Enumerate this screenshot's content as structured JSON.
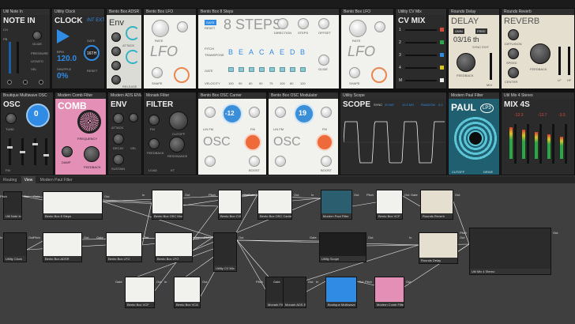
{
  "row1": {
    "note_in": {
      "header": "Util Note In",
      "name": "NOTE IN",
      "tags": [
        "CH",
        "PB",
        "MOD",
        "GLIDE",
        "PRESSURE",
        "LEGATO",
        "VEL"
      ]
    },
    "clock": {
      "header": "Utility Clock",
      "name": "CLOCK",
      "int_ext": "INT EXT",
      "bpm_label": "BPM",
      "bpm": "120.0",
      "shuffle_label": "SHUFFLE",
      "shuffle": "0%",
      "gate_label": "GATE",
      "rate": "16th",
      "reset": "RESET"
    },
    "env": {
      "header": "Bento Box ADSR",
      "name": "Env",
      "tags": [
        "ATTACK",
        "DECAY",
        "SUSTAIN",
        "RELEASE"
      ]
    },
    "lfo1": {
      "header": "Bento Box LFO",
      "name": "LFO",
      "tags": [
        "RATE",
        "PHASE",
        "SHAPE"
      ]
    },
    "steps": {
      "header": "Bento Box 8 Steps",
      "name": "8 STEPS",
      "gate_btn": "GATE",
      "reset_btn": "RESET",
      "notes": [
        "B",
        "E",
        "A",
        "C",
        "A",
        "E",
        "D",
        "B"
      ],
      "values": [
        "100",
        "90",
        "80",
        "90",
        "75",
        "100",
        "80",
        "100"
      ],
      "rows": [
        "PITCH",
        "TRANSPOSE",
        "GATE",
        "VELOCITY"
      ],
      "tags": [
        "DIRECTION",
        "STEPS",
        "OFFSET",
        "GLIDE"
      ]
    },
    "lfo2": {
      "header": "Bento Box LFO",
      "name": "LFO",
      "tags": [
        "RATE",
        "PHASE",
        "SHAPE"
      ]
    },
    "cvmix": {
      "header": "Utility CV Mix",
      "name": "CV MIX",
      "channels": [
        "1",
        "2",
        "3",
        "4",
        "M"
      ]
    },
    "delay": {
      "header": "Rounds Delay",
      "name": "DELAY",
      "toggle_a": "OWN",
      "toggle_b": "FREE",
      "time": "03/16 th",
      "sync": "SYNC EXIT",
      "tags": [
        "FEEDBACK",
        "DRY/WET",
        "MIX"
      ]
    },
    "reverb": {
      "header": "Rounds Reverb",
      "name": "REVERB",
      "tags": [
        "DIFFUSION",
        "SPEED",
        "CENTER",
        "FEEDBACK",
        "LF",
        "HF"
      ]
    }
  },
  "row2": {
    "osc": {
      "header": "Boutique Multiwave OSC",
      "name": "OSC",
      "value": "0",
      "tags": [
        "TUNE",
        "SHAPE",
        "FM",
        "PWM"
      ]
    },
    "comb": {
      "header": "Modern Comb Filter",
      "name": "COMB",
      "tags": [
        "FREQUENCY",
        "FEEDBACK",
        "DAMP",
        "MIX"
      ]
    },
    "env2": {
      "header": "Modern ADS ENV",
      "name": "ENV",
      "tags": [
        "ATTACK",
        "MODE",
        "DECAY",
        "VEL",
        "SUSTAIN"
      ]
    },
    "filter": {
      "header": "Monark Filter",
      "name": "FILTER",
      "tags": [
        "FM",
        "CUTOFF",
        "FEEDBACK",
        "RESONANCE",
        "LOAD",
        "KT"
      ]
    },
    "osc_carrier": {
      "header": "Bento Box OSC Carrier",
      "name": "OSC",
      "value": "-12",
      "tags": [
        "PW",
        "SYNC",
        "LIN FM",
        "FM",
        "SHAPE",
        "BOOST"
      ]
    },
    "osc_mod": {
      "header": "Bento Box OSC Modulator",
      "name": "OSC",
      "value": "19",
      "tags": [
        "PW",
        "SYNC",
        "LIN FM",
        "FM",
        "SHAPE",
        "BOOST"
      ]
    },
    "scope": {
      "header": "Utility Scope",
      "name": "SCOPE",
      "sync": "SYNC",
      "time": "20 ms",
      "value1": "10.0 ms",
      "trigger": "Random",
      "level": "0.0"
    },
    "paul": {
      "header": "Modern Paul Filter",
      "name": "PAUL",
      "badge": "LP3",
      "tags": [
        "CUTOFF",
        "RES",
        "DRIVE"
      ]
    },
    "mix": {
      "header": "Util Mix 4 Stereo",
      "name": "MIX 4S",
      "levels": [
        "-12.3",
        "-13.7",
        "-3.5"
      ]
    }
  },
  "tabs": {
    "items": [
      "Routing",
      "View",
      "Modern Paul Filter"
    ],
    "active": 1
  },
  "patch": {
    "nodes": [
      {
        "label": "Util Note In"
      },
      {
        "label": "Bento Box 8 Steps"
      },
      {
        "label": "Bento Box OSC Modulator"
      },
      {
        "label": "Bento Box CVF"
      },
      {
        "label": "Bento Box OSC Carrier"
      },
      {
        "label": "Modern Paul Filter"
      },
      {
        "label": "Bento Box VCF"
      },
      {
        "label": "Rounds Reverb"
      },
      {
        "label": "Utility Clock"
      },
      {
        "label": "Bento Box ADSR"
      },
      {
        "label": "Bento Box LFO"
      },
      {
        "label": "Bento Box LFO"
      },
      {
        "label": "Utility CV Mix"
      },
      {
        "label": "Utility Scope"
      },
      {
        "label": "Rounds Delay"
      },
      {
        "label": "Util Mix 4 Stereo"
      },
      {
        "label": "Bento Box VCF"
      },
      {
        "label": "Bento Box VCA"
      },
      {
        "label": "Monark Filter"
      },
      {
        "label": "Monark ADS ENV"
      },
      {
        "label": "Boutique Multiwave OSC"
      },
      {
        "label": "Modern Comb Filter"
      }
    ],
    "ports": {
      "out": "Out",
      "gate": "Gate",
      "pitch": "Pitch",
      "reset": "Reset",
      "vel": "Vel",
      "in": "In",
      "fm": "FM",
      "mod": "Mod",
      "rate": "Rate",
      "clk": "Clk",
      "l": "L",
      "r": "R",
      "cv": "CV",
      "cut": "Cut",
      "res": "Res"
    }
  }
}
